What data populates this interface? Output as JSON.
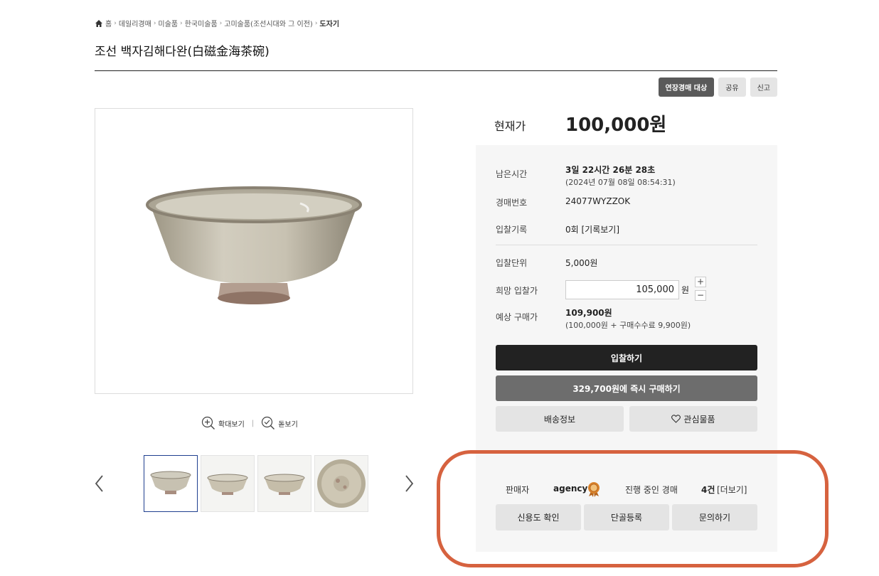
{
  "breadcrumb": {
    "home_icon": "home-icon",
    "items": [
      "홈",
      "데일리경매",
      "미술품",
      "한국미술품",
      "고미술품(조선시대와 그 이전)",
      "도자기"
    ],
    "separator": "›"
  },
  "title": "조선 백자김해다완(白磁金海茶碗)",
  "top_buttons": {
    "extended": "연장경매 대상",
    "share": "공유",
    "report": "신고"
  },
  "image_tools": {
    "zoom_in": "확대보기",
    "separator": "|",
    "magnifier": "돋보기"
  },
  "price": {
    "label": "현재가",
    "value": "100,000원"
  },
  "info": {
    "remaining_label": "남은시간",
    "remaining_value": "3일 22시간 26분 28초",
    "end_time": "(2024년 07월 08일 08:54:31)",
    "auction_no_label": "경매번호",
    "auction_no": "24077WYZZOK",
    "bid_history_label": "입찰기록",
    "bid_history_value": "0회 [기록보기]",
    "bid_unit_label": "입찰단위",
    "bid_unit_value": "5,000원",
    "desired_bid_label": "희망 입찰가",
    "desired_bid_value": "105,000",
    "won": "원",
    "plus": "+",
    "minus": "−",
    "expected_label": "예상 구매가",
    "expected_value": "109,900원",
    "expected_detail": "(100,000원 + 구매수수료 9,900원)"
  },
  "buttons": {
    "bid": "입찰하기",
    "buy_now": "329,700원에 즉시 구매하기",
    "shipping": "배송정보",
    "wishlist": "관심물품"
  },
  "seller": {
    "label": "판매자",
    "name": "agency",
    "ongoing_label": "진행 중인 경매",
    "ongoing_count": "4건",
    "more": "[더보기]",
    "credit": "신용도 확인",
    "regular": "단골등록",
    "inquiry": "문의하기"
  },
  "colors": {
    "accent_dark": "#222222",
    "highlight": "#d6623f",
    "thumb_active": "#1f3f8f"
  }
}
